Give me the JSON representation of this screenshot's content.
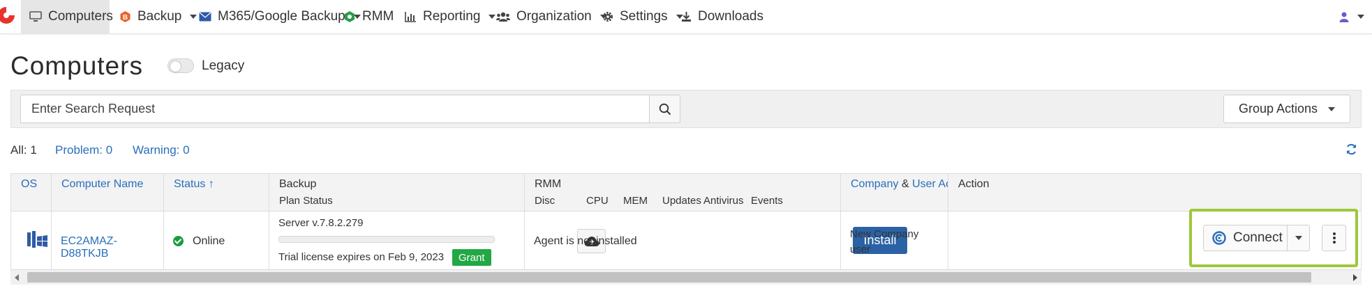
{
  "nav": {
    "computers": "Computers",
    "backup": "Backup",
    "m365": "M365/Google Backup",
    "rmm": "RMM",
    "reporting": "Reporting",
    "organization": "Organization",
    "settings": "Settings",
    "downloads": "Downloads"
  },
  "page": {
    "title": "Computers",
    "legacy_label": "Legacy",
    "legacy_enabled": false
  },
  "search": {
    "placeholder": "Enter Search Request",
    "value": ""
  },
  "group_actions_label": "Group Actions",
  "filters": {
    "all": "All: 1",
    "problem": "Problem: 0",
    "warning": "Warning: 0"
  },
  "table": {
    "headers": {
      "os": "OS",
      "computer_name": "Computer Name",
      "status": "Status",
      "status_sort": "↑",
      "backup": "Backup",
      "plan_status": "Plan Status",
      "rmm": "RMM",
      "rmm_sub": [
        "Disc",
        "CPU",
        "MEM",
        "Updates",
        "Antivirus",
        "Events"
      ],
      "company": "Company",
      "amp": "&",
      "user_account": "User Account",
      "action": "Action"
    },
    "rows": [
      {
        "computer_name": "EC2AMAZ-D88TKJB",
        "status": "Online",
        "server_version": "Server v.7.8.2.279",
        "trial": "Trial license expires on Feb 9, 2023",
        "grant": "Grant",
        "agent_status": "Agent is not installed",
        "install": "Install",
        "company": "New Company",
        "user": "user",
        "connect": "Connect"
      }
    ]
  },
  "colors": {
    "accent": "#2a6ebb",
    "install": "#2a62a5",
    "online": "#1a9c3e",
    "grant": "#22a845",
    "highlight": "#9dc83a",
    "brand": "#e8322b"
  }
}
